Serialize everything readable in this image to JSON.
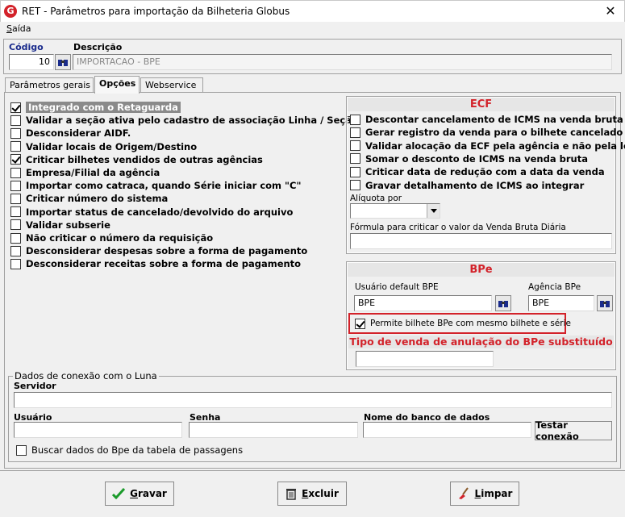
{
  "window": {
    "app_icon": "G",
    "title": "RET - Parâmetros para importação da Bilheteria Globus",
    "close": "✕"
  },
  "menu": {
    "saida_first": "S",
    "saida_rest": "aída"
  },
  "codigo": {
    "label": "Código",
    "value": "10"
  },
  "descricao": {
    "label": "Descrição",
    "value": "IMPORTACAO - BPE"
  },
  "tabs": [
    {
      "label": "Parâmetros gerais"
    },
    {
      "label": "Opções"
    },
    {
      "label": "Webservice"
    }
  ],
  "options": [
    {
      "label": "Integrado com o Retaguarda",
      "checked": true
    },
    {
      "label": "Validar a seção ativa pelo cadastro de associação Linha / Seção",
      "checked": false
    },
    {
      "label": "Desconsiderar AIDF.",
      "checked": false
    },
    {
      "label": "Validar locais de Origem/Destino",
      "checked": false
    },
    {
      "label": "Criticar bilhetes vendidos de outras agências",
      "checked": true
    },
    {
      "label": "Empresa/Filial da agência",
      "checked": false
    },
    {
      "label": "Importar como catraca, quando Série iniciar com \"C\"",
      "checked": false
    },
    {
      "label": "Criticar número do sistema",
      "checked": false
    },
    {
      "label": "Importar status de cancelado/devolvido do arquivo",
      "checked": false
    },
    {
      "label": "Validar subserie",
      "checked": false
    },
    {
      "label": "Não criticar o número da requisição",
      "checked": false
    },
    {
      "label": "Desconsiderar despesas sobre a forma de pagamento",
      "checked": false
    },
    {
      "label": "Desconsiderar receitas sobre a forma de pagamento",
      "checked": false
    }
  ],
  "ecf": {
    "title": "ECF",
    "options": [
      {
        "label": "Descontar cancelamento de ICMS na venda bruta",
        "checked": false
      },
      {
        "label": "Gerar registro da venda para o bilhete cancelado",
        "checked": false
      },
      {
        "label": "Validar alocação da ECF pela agência e não pela loja",
        "checked": false
      },
      {
        "label": "Somar o desconto de ICMS na venda bruta",
        "checked": false
      },
      {
        "label": "Criticar data de redução com a data da venda",
        "checked": false
      },
      {
        "label": "Gravar detalhamento de ICMS ao integrar",
        "checked": false
      }
    ],
    "aliquota_label": "Alíquota por",
    "aliquota_value": "",
    "formula_label": "Fórmula para criticar o valor da Venda Bruta Diária",
    "formula_value": ""
  },
  "bpe": {
    "title": "BPe",
    "usuario_label": "Usuário default BPE",
    "usuario_value": "BPE",
    "agencia_label": "Agência BPe",
    "agencia_value": "BPE",
    "permite_label": "Permite bilhete BPe com mesmo bilhete e série",
    "permite_checked": true,
    "highlight_color": "#d3222a",
    "tipo_title": "Tipo de venda de anulação do BPe substituído",
    "tipo_value": ""
  },
  "luna": {
    "group_label": "Dados de conexão com o Luna",
    "servidor_label": "Servidor",
    "servidor_value": "",
    "usuario_label": "Usuário",
    "usuario_value": "",
    "senha_label": "Senha",
    "senha_value": "",
    "banco_label": "Nome do banco de dados",
    "banco_value": "",
    "testar_label": "Testar conexão",
    "buscar_label": "Buscar dados do Bpe da tabela de passagens",
    "buscar_checked": false
  },
  "footer": {
    "gravar_first": "G",
    "gravar_rest": "ravar",
    "excluir_first": "E",
    "excluir_rest": "xcluir",
    "limpar_first": "L",
    "limpar_rest": "impar"
  },
  "colors": {
    "ecf_header": "#d3222a",
    "label_blue": "#1a2b8c"
  }
}
